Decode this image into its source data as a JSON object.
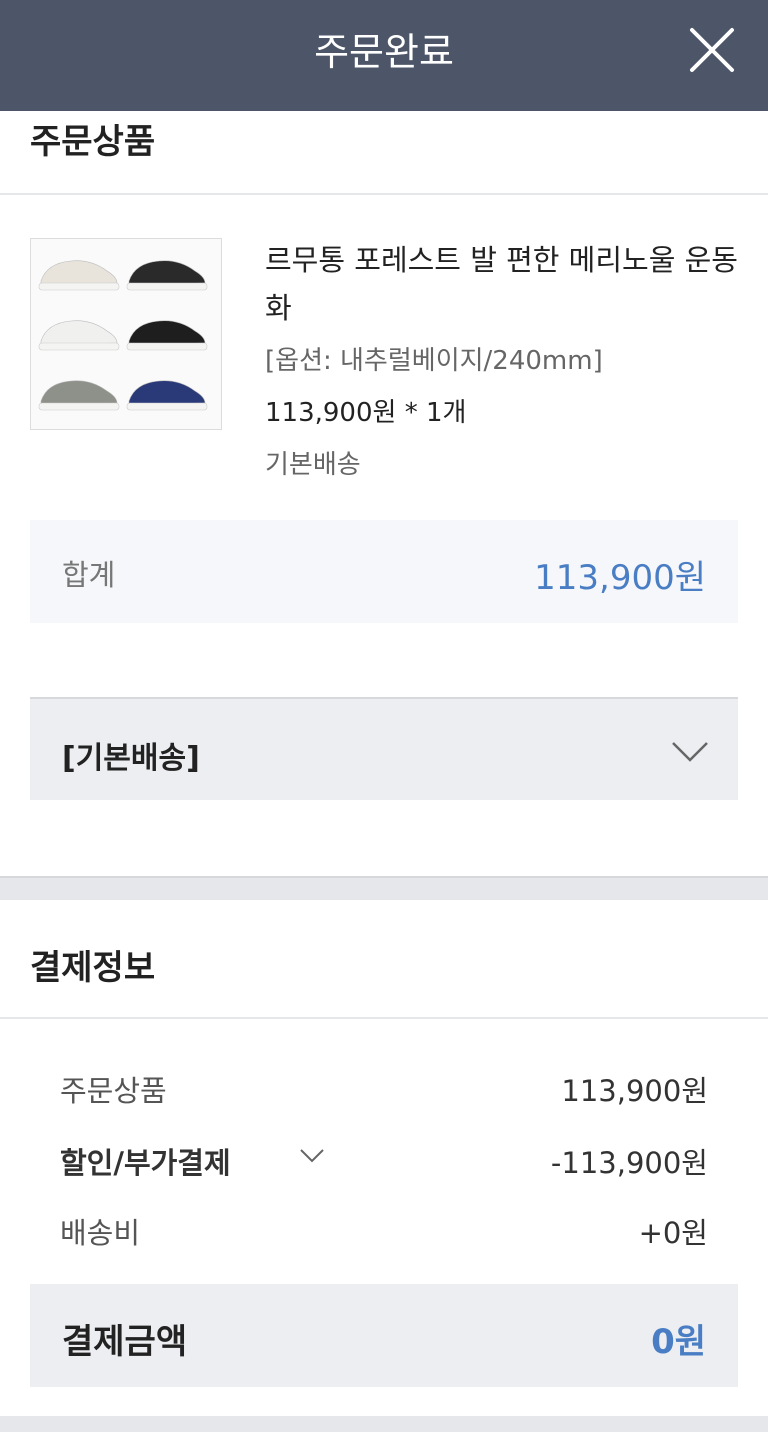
{
  "header": {
    "title": "주문완료"
  },
  "order_items": {
    "section_title": "주문상품",
    "product": {
      "name": "르무통 포레스트 발 편한 메리노울 운동화",
      "option": "[옵션: 내추럴베이지/240mm]",
      "price": "113,900원 *  1개",
      "shipping": "기본배송",
      "image_colors": [
        "#e8e4dc",
        "#2a2a2a",
        "#f0f0ee",
        "#1e1e1e",
        "#8e908a",
        "#2a3a78"
      ]
    },
    "subtotal": {
      "label": "합계",
      "value": "113,900원"
    },
    "delivery_group": {
      "label": "[기본배송]"
    }
  },
  "payment": {
    "section_title": "결제정보",
    "rows": [
      {
        "label": "주문상품",
        "value": "113,900원"
      },
      {
        "label": "할인/부가결제",
        "value": "-113,900원"
      },
      {
        "label": "배송비",
        "value": "+0원"
      }
    ],
    "total": {
      "label": "결제금액",
      "value": "0원"
    }
  },
  "colors": {
    "header_bg": "#4d5568",
    "accent_blue": "#4a7ec4"
  }
}
